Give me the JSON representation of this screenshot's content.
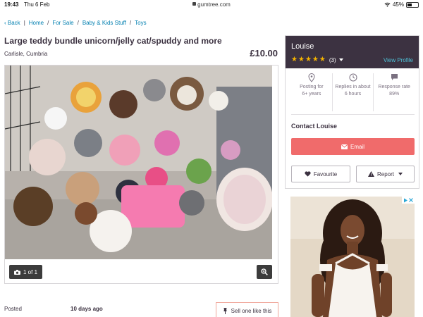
{
  "status_bar": {
    "time": "19:43",
    "date": "Thu 6 Feb",
    "url": "gumtree.com",
    "battery": "45%"
  },
  "breadcrumb": {
    "back": "Back",
    "items": [
      "Home",
      "For Sale",
      "Baby & Kids Stuff",
      "Toys"
    ]
  },
  "listing": {
    "title": "Large teddy bundle unicorn/jelly cat/spuddy and more",
    "location": "Carlisle, Cumbria",
    "price": "£10.00",
    "photo_count": "1 of 1",
    "posted_label": "Posted",
    "posted_value": "10 days ago",
    "sell_one_label": "Sell one like this"
  },
  "seller": {
    "name": "Louise",
    "rating_stars": 5,
    "rating_count": "(3)",
    "view_profile": "View Profile",
    "stats": [
      {
        "icon": "location-pin-icon",
        "label": "Posting for",
        "value": "6+ years"
      },
      {
        "icon": "clock-icon",
        "label": "Replies in about",
        "value": "6 hours"
      },
      {
        "icon": "speech-bubble-icon",
        "label": "Response rate",
        "value": "89%"
      }
    ],
    "contact_title": "Contact Louise",
    "email_label": "Email",
    "favourite_label": "Favourite",
    "report_label": "Report"
  },
  "colors": {
    "brand_dark": "#3c3241",
    "email_button": "#f06b6b",
    "link": "#007fb0",
    "star": "#f5b400",
    "sell_border": "#f0a69a"
  }
}
